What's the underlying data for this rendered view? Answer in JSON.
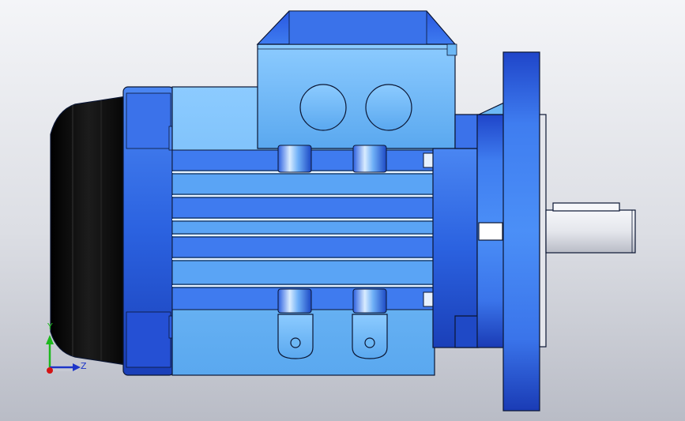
{
  "viewport": {
    "background_top": "#f4f5f8",
    "background_bottom": "#b9bcc6"
  },
  "model": {
    "type": "flange-mounted electric motor",
    "body_color": "#6db8f5",
    "dark_color": "#2a5fe0",
    "outline_color": "#0b1633",
    "fan_cover_color": "#101010",
    "shaft_color": "#e6e8ee"
  },
  "triad": {
    "y_label": "Y",
    "z_label": "Z",
    "y_color": "#1db81d",
    "z_color": "#1d35c8",
    "x_color": "#d41414"
  }
}
